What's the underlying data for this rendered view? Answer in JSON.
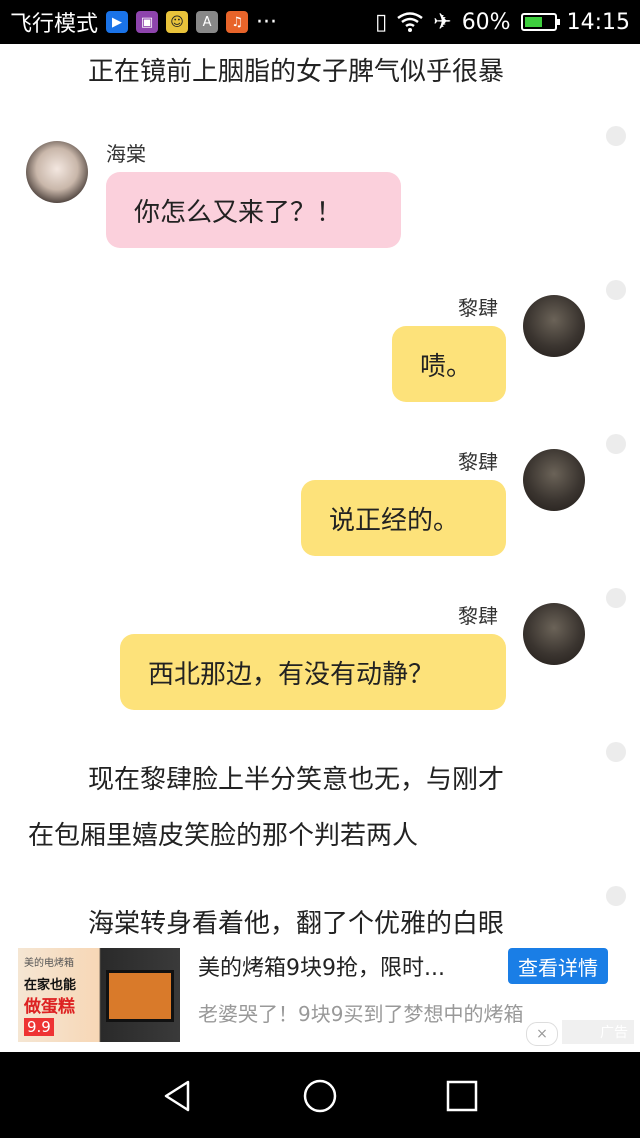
{
  "status_bar": {
    "airplane_mode_label": "飞行模式",
    "app_icons": [
      "play-store-icon",
      "gallery-icon",
      "chat-icon",
      "font-icon",
      "music-icon"
    ],
    "more": "···",
    "battery_percent": "60%",
    "time": "14:15",
    "battery_level": 0.6
  },
  "story": {
    "intro": "正在镜前上胭脂的女子脾气似乎很暴",
    "narration1_line1": "现在黎肆脸上半分笑意也无，与刚才",
    "narration1_line2": "在包厢里嬉皮笑脸的那个判若两人",
    "narration2": "海棠转身看着他，翻了个优雅的白眼"
  },
  "messages": [
    {
      "speaker": "海棠",
      "text": "你怎么又来了？！",
      "side": "left",
      "color": "#fbd0dc"
    },
    {
      "speaker": "黎肆",
      "text": "啧。",
      "side": "right",
      "color": "#fde27a"
    },
    {
      "speaker": "黎肆",
      "text": "说正经的。",
      "side": "right",
      "color": "#fde27a"
    },
    {
      "speaker": "黎肆",
      "text": "西北那边，有没有动静？",
      "side": "right",
      "color": "#fde27a"
    }
  ],
  "ad": {
    "image_line1": "美的电烤箱",
    "image_line2": "在家也能",
    "image_line3": "做蛋糕",
    "image_price": "9.9",
    "title": "美的烤箱9块9抢，限时...",
    "button": "查看详情",
    "subtitle": "老婆哭了！9块9买到了梦想中的烤箱",
    "close": "×",
    "tag": "广告"
  },
  "navbar": {
    "icons": [
      "back-icon",
      "home-icon",
      "recents-icon"
    ]
  }
}
